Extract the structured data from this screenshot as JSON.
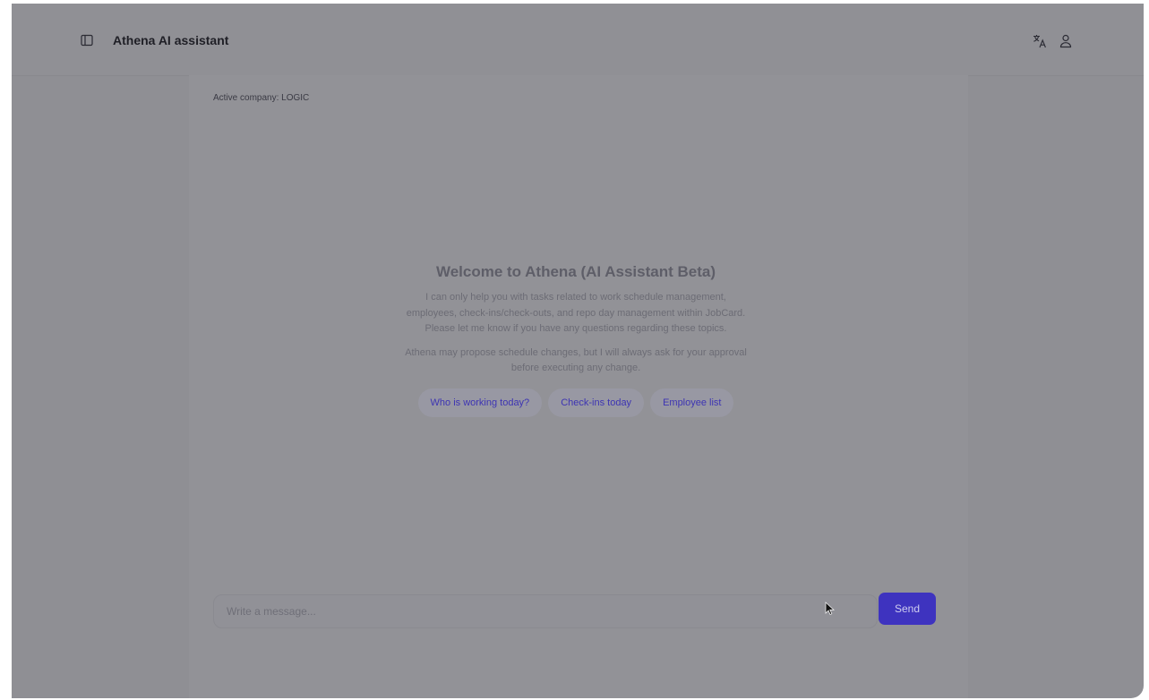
{
  "header": {
    "title": "Athena AI assistant",
    "icons": {
      "sidebar_toggle": "sidebar-toggle-icon",
      "translate": "translate-icon",
      "user": "user-icon"
    }
  },
  "main": {
    "active_company": "Active company: LOGIC",
    "welcome": {
      "title": "Welcome to Athena (AI Assistant Beta)",
      "paragraph_1": "I can only help you with tasks related to work schedule management, employees, check-ins/check-outs, and repo day management within JobCard. Please let me know if you have any questions regarding these topics.",
      "paragraph_2": "Athena may propose schedule changes, but I will always ask for your approval before executing any change."
    },
    "suggestions": [
      {
        "label": "Who is working today?"
      },
      {
        "label": "Check-ins today"
      },
      {
        "label": "Employee list"
      }
    ]
  },
  "composer": {
    "value": "",
    "placeholder": "Write a message...",
    "send_label": "Send"
  },
  "colors": {
    "overlay_background": "#8f8f94",
    "accent": "#3e33bf",
    "chip_text": "#3d34b3"
  }
}
